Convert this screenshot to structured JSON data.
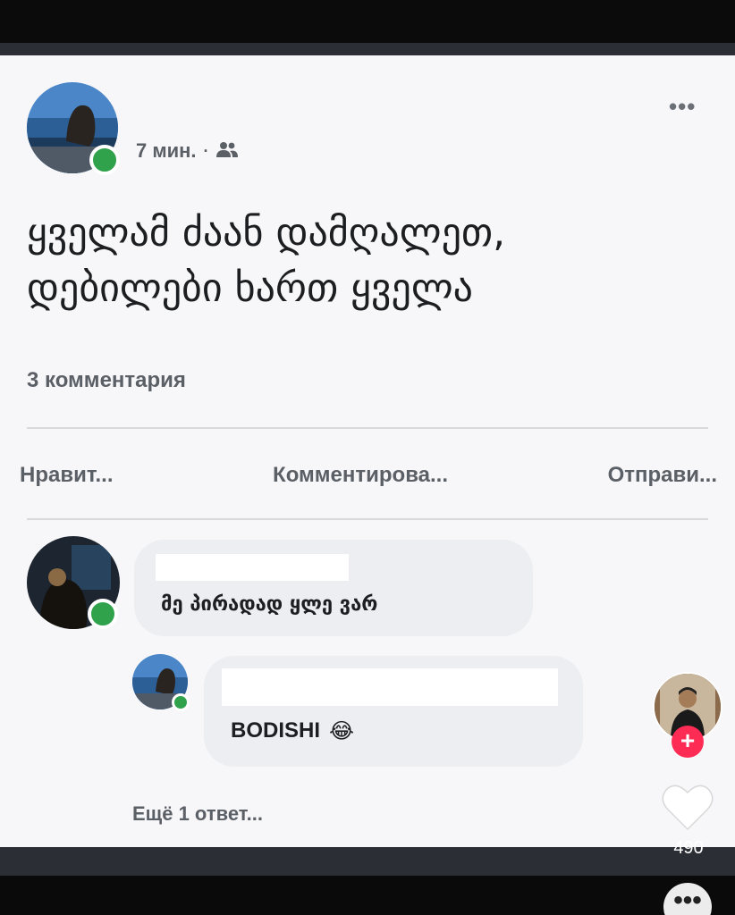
{
  "post": {
    "time": "7 мин.",
    "separator": "·",
    "audience_icon": "friends-icon",
    "more_icon": "•••",
    "text_line1": "ყველამ ძაან დამღალეთ,",
    "text_line2": "დებილები ხართ ყველა",
    "comments_count": "3 комментария"
  },
  "actions": {
    "like": "Нравит...",
    "comment": "Комментирова...",
    "share": "Отправи..."
  },
  "comments": [
    {
      "text": "მე პირადად ყლე ვარ"
    },
    {
      "text": "BODISHI",
      "emoji": "😂"
    }
  ],
  "more_replies": "Ещё 1 ответ...",
  "overlay": {
    "plus": "+",
    "likes": "490",
    "more": "•••"
  },
  "colors": {
    "online": "#31a24c",
    "follow": "#fe2c55"
  }
}
